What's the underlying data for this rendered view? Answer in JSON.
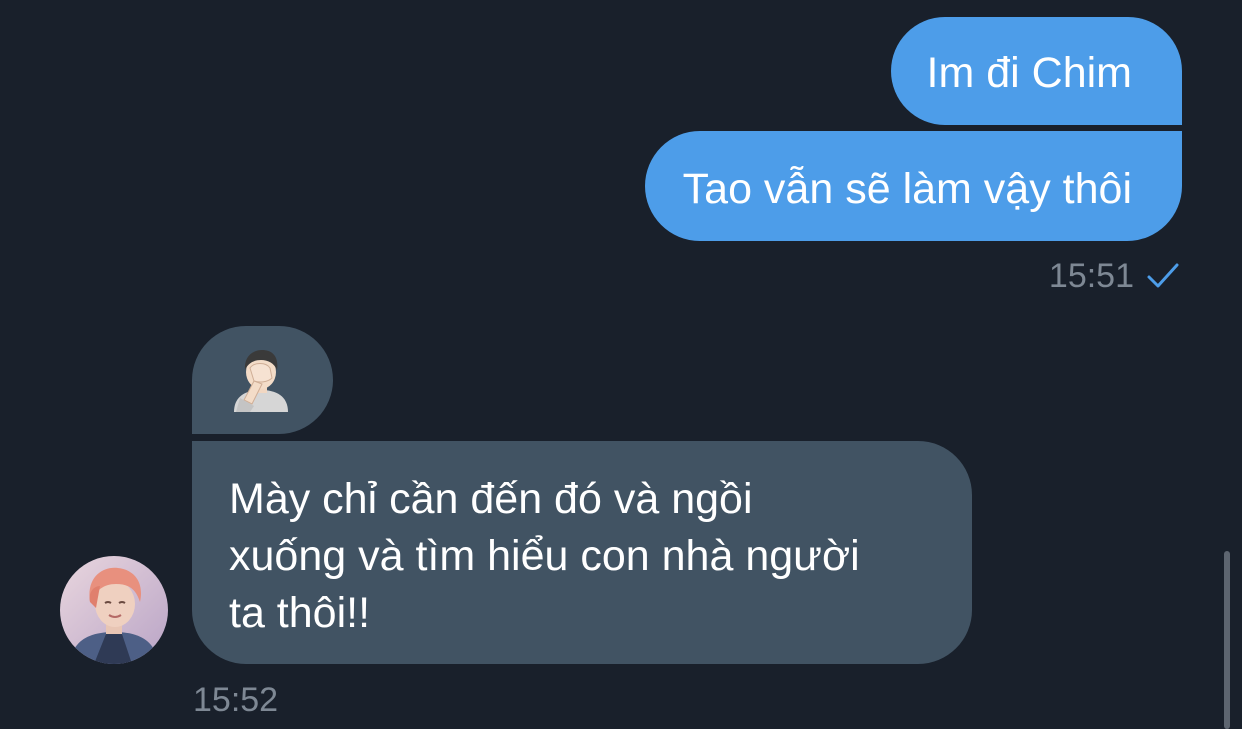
{
  "messages": {
    "outgoing": [
      {
        "text": "Im đi Chim"
      },
      {
        "text": "Tao vẫn sẽ làm vậy thôi"
      }
    ],
    "outgoing_time": "15:51",
    "outgoing_status_icon": "check-icon",
    "incoming_emoji": "facepalm-emoji",
    "incoming_text_lines": [
      "Mày chỉ cần đến đó và ngồi",
      "xuống và tìm hiểu con nhà người",
      "ta thôi!!"
    ],
    "incoming_time": "15:52"
  },
  "colors": {
    "background": "#19202b",
    "outgoing_bubble": "#4d9de9",
    "incoming_bubble": "#415363",
    "timestamp": "#7e8894",
    "check": "#4d9de9"
  }
}
